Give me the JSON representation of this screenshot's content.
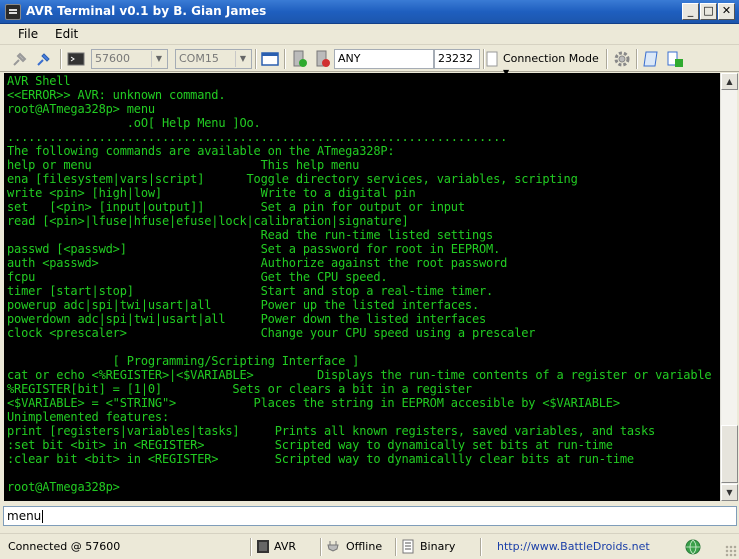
{
  "window": {
    "title": "AVR Terminal v0.1 by B. Gian James",
    "minimize_label": "_",
    "maximize_label": "□",
    "close_label": "✕"
  },
  "menu": {
    "items": [
      {
        "label": "File"
      },
      {
        "label": "Edit"
      }
    ]
  },
  "toolbar": {
    "baud_rate": "57600",
    "port": "COM15",
    "address": "ANY",
    "tcp_port": "23232",
    "connection_mode_label": "Connection Mode"
  },
  "terminal": {
    "lines": [
      "AVR Shell",
      "<<ERROR>> AVR: unknown command.",
      "root@ATmega328p> menu",
      "                 .oO[ Help Menu ]Oo.",
      ".......................................................................",
      "The following commands are available on the ATmega328P:",
      "help or menu                        This help menu",
      "ena [filesystem|vars|script]      Toggle directory services, variables, scripting",
      "write <pin> [high|low]              Write to a digital pin",
      "set   [<pin> [input|output]]        Set a pin for output or input",
      "read [<pin>|lfuse|hfuse|efuse|lock|calibration|signature]",
      "                                    Read the run-time listed settings",
      "passwd [<passwd>]                   Set a password for root in EEPROM.",
      "auth <passwd>                       Authorize against the root password",
      "fcpu                                Get the CPU speed.",
      "timer [start|stop]                  Start and stop a real-time timer.",
      "powerup adc|spi|twi|usart|all       Power up the listed interfaces.",
      "powerdown adc|spi|twi|usart|all     Power down the listed interfaces",
      "clock <prescaler>                   Change your CPU speed using a prescaler",
      "",
      "               [ Programming/Scripting Interface ]",
      "cat or echo <%REGISTER>|<$VARIABLE>         Displays the run-time contents of a register or variable",
      "%REGISTER[bit] = [1|0]          Sets or clears a bit in a register",
      "<$VARIABLE> = <\"STRING\">           Places the string in EEPROM accesible by <$VARIABLE>",
      "Unimplemented features:",
      "print [registers|variables|tasks]     Prints all known registers, saved variables, and tasks",
      ":set bit <bit> in <REGISTER>          Scripted way to dynamically set bits at run-time",
      ":clear bit <bit> in <REGISTER>        Scripted way to dynamicallly clear bits at run-time",
      "",
      "root@ATmega328p>"
    ],
    "text_color": "#22cc22",
    "background_color": "#000000"
  },
  "command_input": {
    "value": "menu"
  },
  "status": {
    "connection": "Connected @ 57600",
    "device": "AVR",
    "mode": "Offline",
    "format": "Binary",
    "url": "http://www.BattleDroids.net"
  }
}
